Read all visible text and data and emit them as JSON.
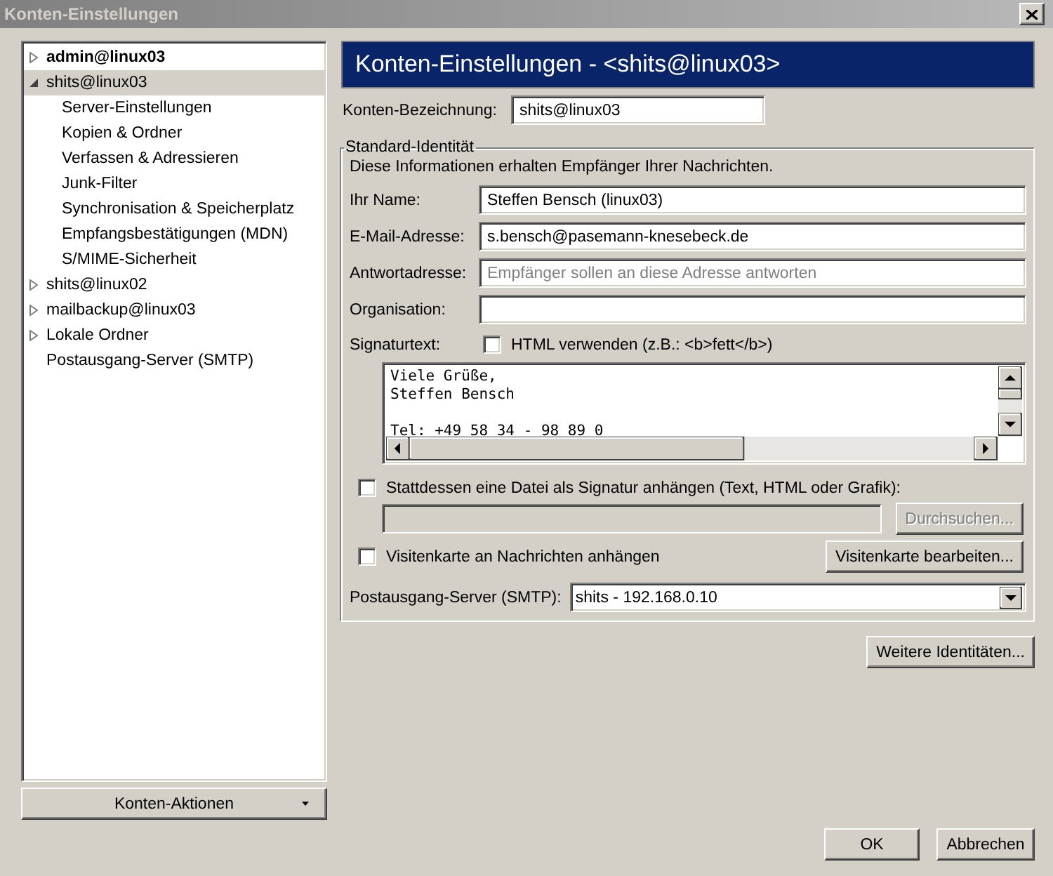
{
  "window": {
    "title": "Konten-Einstellungen"
  },
  "tree": [
    {
      "label": "admin@linux03",
      "bold": true,
      "expanded": false,
      "selected": false,
      "expandable": true
    },
    {
      "label": "shits@linux03",
      "bold": false,
      "expanded": true,
      "selected": true,
      "expandable": true,
      "children": [
        {
          "label": "Server-Einstellungen",
          "selected": false
        },
        {
          "label": "Kopien & Ordner",
          "selected": false
        },
        {
          "label": "Verfassen & Adressieren",
          "selected": false
        },
        {
          "label": "Junk-Filter",
          "selected": false
        },
        {
          "label": "Synchronisation & Speicherplatz",
          "selected": false
        },
        {
          "label": "Empfangsbestätigungen (MDN)",
          "selected": false
        },
        {
          "label": "S/MIME-Sicherheit",
          "selected": false
        }
      ]
    },
    {
      "label": "shits@linux02",
      "bold": false,
      "expanded": false,
      "selected": false,
      "expandable": true
    },
    {
      "label": "mailbackup@linux03",
      "bold": false,
      "expanded": false,
      "selected": false,
      "expandable": true
    },
    {
      "label": "Lokale Ordner",
      "bold": false,
      "expanded": false,
      "selected": false,
      "expandable": true
    },
    {
      "label": "Postausgang-Server (SMTP)",
      "bold": false,
      "selected": false,
      "expandable": false
    }
  ],
  "account_actions_button": "Konten-Aktionen",
  "header": "Konten-Einstellungen - <shits@linux03>",
  "account_name": {
    "label": "Konten-Bezeichnung:",
    "value": "shits@linux03"
  },
  "identity": {
    "legend": "Standard-Identität",
    "description": "Diese Informationen erhalten Empfänger Ihrer Nachrichten.",
    "fields": [
      {
        "label": "Ihr Name:",
        "value": "Steffen Bensch (linux03)"
      },
      {
        "label": "E-Mail-Adresse:",
        "value": "s.bensch@pasemann-knesebeck.de"
      },
      {
        "label": "Antwortadresse:",
        "placeholder": "Empfänger sollen an diese Adresse antworten"
      },
      {
        "label": "Organisation:"
      }
    ],
    "signature_label": "Signaturtext:",
    "html_checkbox": {
      "label": "HTML verwenden (z.B.: <b>fett</b>)",
      "checked": false
    },
    "signature_text": "Viele Grüße,\nSteffen Bensch\n\nTel: +49 58 34 - 98 89 0",
    "file_checkbox": {
      "label": "Stattdessen eine Datei als Signatur anhängen (Text, HTML oder Grafik):",
      "checked": false
    },
    "browse_button": {
      "label": "Durchsuchen...",
      "disabled": true
    },
    "vcard_checkbox": {
      "label": "Visitenkarte an Nachrichten anhängen",
      "checked": false
    },
    "vcard_button": "Visitenkarte bearbeiten...",
    "smtp": {
      "label": "Postausgang-Server (SMTP):",
      "value": "shits - 192.168.0.10"
    }
  },
  "more_identities_button": "Weitere Identitäten...",
  "buttons": [
    "OK",
    "Abbrechen"
  ]
}
